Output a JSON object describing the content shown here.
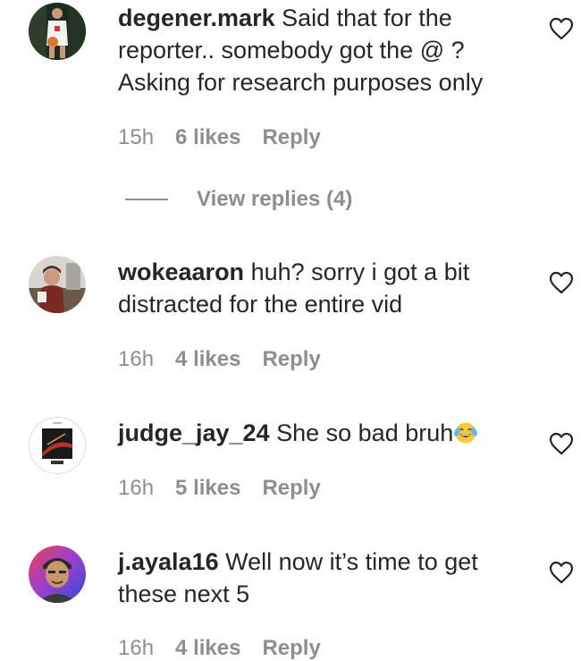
{
  "comments": [
    {
      "username": "degener.mark",
      "text": "Said that for the reporter.. somebody got the @ ? Asking for research purposes only",
      "time": "15h",
      "likes": "6 likes",
      "reply_label": "Reply",
      "avatar_icon": "basketball-player-avatar"
    },
    {
      "username": "wokeaaron",
      "text": "huh? sorry i got a bit distracted for the entire vid",
      "time": "16h",
      "likes": "4 likes",
      "reply_label": "Reply",
      "avatar_icon": "person-photo-avatar"
    },
    {
      "username": "judge_jay_24",
      "text": "She so bad bruh",
      "emoji": "laughing-tears-emoji",
      "time": "16h",
      "likes": "5 likes",
      "reply_label": "Reply",
      "avatar_icon": "album-cover-avatar"
    },
    {
      "username": "j.ayala16",
      "text": "Well now it’s time to get these next 5",
      "time": "16h",
      "likes": "4 likes",
      "reply_label": "Reply",
      "avatar_icon": "cartoon-person-avatar"
    }
  ],
  "view_replies": {
    "label": "View replies (4)"
  },
  "colors": {
    "text": "#262626",
    "secondary": "#8e8e8e",
    "background": "#ffffff"
  }
}
